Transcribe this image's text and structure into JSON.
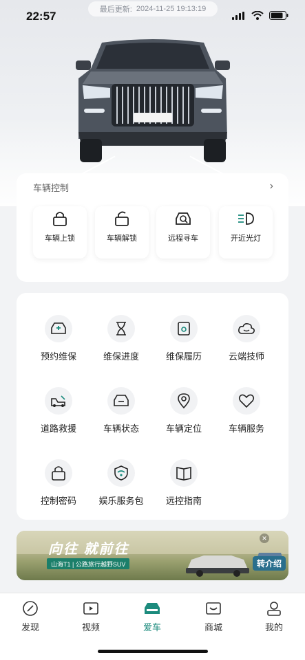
{
  "status_bar": {
    "time": "22:57",
    "last_update_prefix": "最后更新:",
    "last_update_time": "2024-11-25 19:13:19",
    "icons": [
      "signal-icon",
      "wifi-icon",
      "battery-icon"
    ]
  },
  "car": {
    "image": "car-front-image"
  },
  "vehicle_control": {
    "title": "车辆控制",
    "buttons": [
      {
        "label": "车辆上锁",
        "icon": "lock-icon"
      },
      {
        "label": "车辆解锁",
        "icon": "unlock-icon"
      },
      {
        "label": "远程寻车",
        "icon": "find-car-icon"
      },
      {
        "label": "开近光灯",
        "icon": "low-beam-icon"
      }
    ]
  },
  "services": [
    {
      "label": "预约维保",
      "icon": "maintenance-booking-icon"
    },
    {
      "label": "维保进度",
      "icon": "hourglass-icon"
    },
    {
      "label": "维保履历",
      "icon": "history-icon"
    },
    {
      "label": "云端技师",
      "icon": "cloud-icon"
    },
    {
      "label": "道路救援",
      "icon": "tow-truck-icon"
    },
    {
      "label": "车辆状态",
      "icon": "car-status-icon"
    },
    {
      "label": "车辆定位",
      "icon": "location-pin-icon"
    },
    {
      "label": "车辆服务",
      "icon": "heart-icon"
    },
    {
      "label": "控制密码",
      "icon": "password-lock-icon"
    },
    {
      "label": "娱乐服务包",
      "icon": "wifi-shield-icon"
    },
    {
      "label": "远控指南",
      "icon": "book-icon"
    }
  ],
  "banner": {
    "slogan": "向往 就前往",
    "subtitle": "山海T1 | 公路旅行越野SUV",
    "intro_label": "转介绍"
  },
  "tabbar": {
    "tabs": [
      {
        "label": "发现",
        "icon": "compass-icon"
      },
      {
        "label": "视频",
        "icon": "video-icon"
      },
      {
        "label": "爱车",
        "icon": "car-icon"
      },
      {
        "label": "商城",
        "icon": "mall-icon"
      },
      {
        "label": "我的",
        "icon": "profile-icon"
      }
    ],
    "active_index": 2
  },
  "colors": {
    "accent": "#1c8b7d",
    "banner_tag": "#1b7f6a"
  }
}
